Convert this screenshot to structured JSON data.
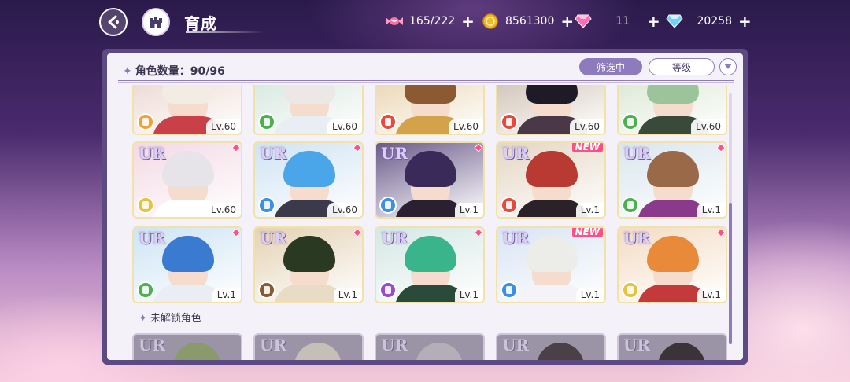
{
  "header": {
    "title": "育成",
    "currencies": [
      {
        "name": "candy-icon",
        "value": "165/222",
        "color": "#ff7aa8"
      },
      {
        "name": "gold-coin-icon",
        "value": "8561300",
        "color": "#f5b921"
      },
      {
        "name": "pink-diamond-icon",
        "value": "11",
        "color": "#ff6fb5"
      },
      {
        "name": "blue-diamond-icon",
        "value": "20258",
        "color": "#6fd3ff"
      }
    ],
    "plus": "+"
  },
  "panel": {
    "count_label": "角色数量：90/96",
    "filter_label": "筛选中",
    "level_label": "等级",
    "locked_label": "未解锁角色"
  },
  "cards": [
    {
      "row": 0,
      "lv": "Lv.60",
      "attr_color": "#f0a23a",
      "hair": "#f2ece4",
      "body": "#c94048",
      "bg": "#e9d2c9",
      "ur": "",
      "new": false
    },
    {
      "row": 0,
      "lv": "Lv.60",
      "attr_color": "#4caf50",
      "hair": "#ece8e6",
      "body": "#e8eef4",
      "bg": "#cfe4d9",
      "ur": "",
      "new": false
    },
    {
      "row": 0,
      "lv": "Lv.60",
      "attr_color": "#e84a3a",
      "hair": "#8c5a32",
      "body": "#d4a24a",
      "bg": "#e6cfa5",
      "ur": "",
      "new": false
    },
    {
      "row": 0,
      "lv": "Lv.60",
      "attr_color": "#e84a3a",
      "hair": "#1e1a26",
      "body": "#4a3848",
      "bg": "#c8b8a8",
      "ur": "",
      "new": false
    },
    {
      "row": 0,
      "lv": "Lv.60",
      "attr_color": "#4caf50",
      "hair": "#9cc49a",
      "body": "#3a4a3a",
      "bg": "#d6e4cc",
      "ur": "",
      "new": false
    },
    {
      "row": 1,
      "lv": "Lv.60",
      "attr_color": "#e8c23a",
      "hair": "#e6e4e8",
      "body": "#ffffff",
      "bg": "#f3d9e4",
      "ur": "UR",
      "new": false
    },
    {
      "row": 1,
      "lv": "Lv.60",
      "attr_color": "#3a8fe8",
      "hair": "#4aa6e8",
      "body": "#3a3a4a",
      "bg": "#cfe3f3",
      "ur": "UR",
      "new": false
    },
    {
      "row": 1,
      "lv": "Lv.1",
      "attr_color": "#3a8fe8",
      "hair": "#3a2a5a",
      "body": "#2a2030",
      "bg": "#6a5a8a",
      "ur": "UR",
      "new": false
    },
    {
      "row": 1,
      "lv": "Lv.1",
      "attr_color": "#e84a3a",
      "hair": "#b83a32",
      "body": "#2a2228",
      "bg": "#e4d6c4",
      "ur": "UR",
      "new": true,
      "new_label": "NEW"
    },
    {
      "row": 1,
      "lv": "Lv.1",
      "attr_color": "#4caf50",
      "hair": "#9a6a48",
      "body": "#8a3a8a",
      "bg": "#d9e6ee",
      "ur": "UR",
      "new": false
    },
    {
      "row": 2,
      "lv": "Lv.1",
      "attr_color": "#4caf50",
      "hair": "#3a7ad0",
      "body": "#e8eef4",
      "bg": "#cde4f4",
      "ur": "UR",
      "new": false
    },
    {
      "row": 2,
      "lv": "Lv.1",
      "attr_color": "#8a5a32",
      "hair": "#2a3a22",
      "body": "#e8dcc4",
      "bg": "#e4d2b4",
      "ur": "UR",
      "new": false
    },
    {
      "row": 2,
      "lv": "Lv.1",
      "attr_color": "#9a4ad0",
      "hair": "#3ab48a",
      "body": "#2a4a3a",
      "bg": "#d4e8e4",
      "ur": "UR",
      "new": false
    },
    {
      "row": 2,
      "lv": "Lv.1",
      "attr_color": "#3a8fe8",
      "hair": "#ecece8",
      "body": "#f4f4f8",
      "bg": "#d9e4f4",
      "ur": "UR",
      "new": true,
      "new_label": "NEW"
    },
    {
      "row": 2,
      "lv": "Lv.1",
      "attr_color": "#e8c23a",
      "hair": "#e88a3a",
      "body": "#c43a3a",
      "bg": "#f3dcc4",
      "ur": "UR",
      "new": false
    }
  ],
  "locked_cards": [
    {
      "ur": "UR",
      "shade": "#8a9a6a"
    },
    {
      "ur": "UR",
      "shade": "#c4c0b8"
    },
    {
      "ur": "UR",
      "shade": "#b4aeb8"
    },
    {
      "ur": "UR",
      "shade": "#4a4048"
    },
    {
      "ur": "UR",
      "shade": "#3a3438"
    }
  ]
}
